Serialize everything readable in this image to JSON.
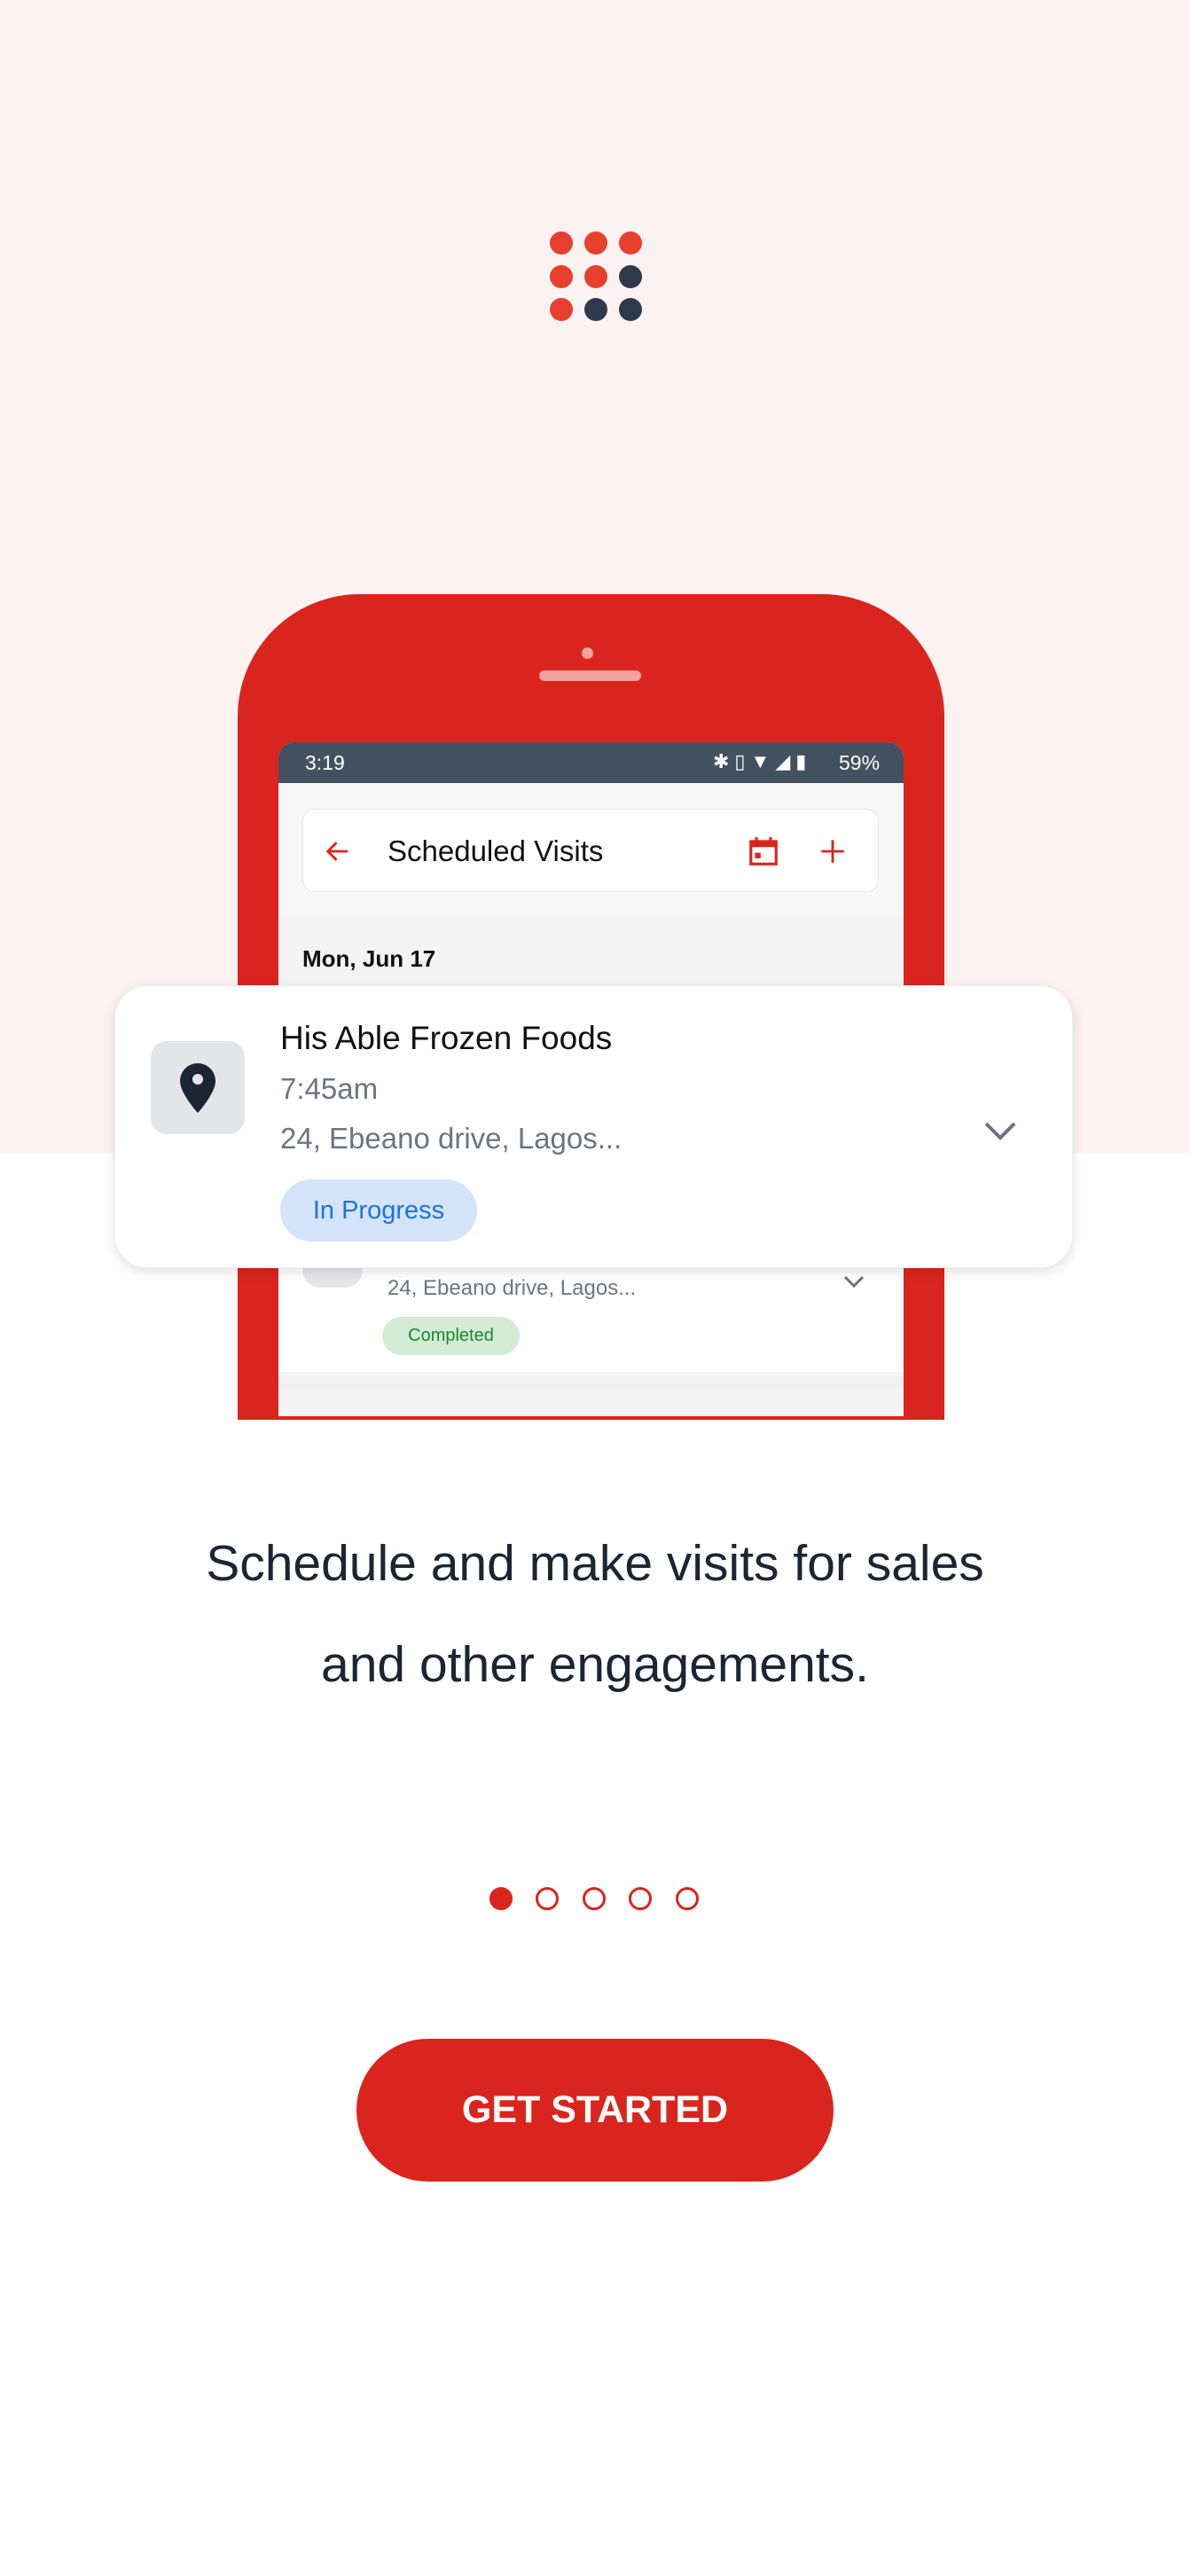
{
  "colors": {
    "brand_red": "#d9251d",
    "navy": "#2d3a4b",
    "pink_bg": "#fdf2f2",
    "in_progress_bg": "#d4e4fa",
    "in_progress_text": "#1a73e8",
    "completed_bg": "#d3ecd6",
    "completed_text": "#1a8a2a"
  },
  "logo": {
    "icon": "nine-dot-grid-logo"
  },
  "phone": {
    "status_bar": {
      "time": "3:19",
      "battery": "59%",
      "icons": [
        "bluetooth-icon",
        "vibrate-icon",
        "wifi-icon",
        "signal-icon",
        "battery-icon"
      ]
    },
    "header": {
      "title": "Scheduled Visits",
      "back_icon": "arrow-left-icon",
      "calendar_icon": "calendar-icon",
      "add_icon": "plus-icon"
    },
    "date_label": "Mon, Jun 17",
    "second_visit": {
      "address": "24, Ebeano drive, Lagos...",
      "status": "Completed"
    }
  },
  "visit_card": {
    "name": "His Able Frozen Foods",
    "time": "7:45am",
    "address": "24, Ebeano drive, Lagos...",
    "status": "In Progress",
    "icon": "map-pin-icon"
  },
  "headline": {
    "line1": "Schedule and make visits for sales",
    "line2": "and other engagements."
  },
  "pagination": {
    "total": 5,
    "current": 1
  },
  "cta": {
    "label": "GET STARTED"
  }
}
